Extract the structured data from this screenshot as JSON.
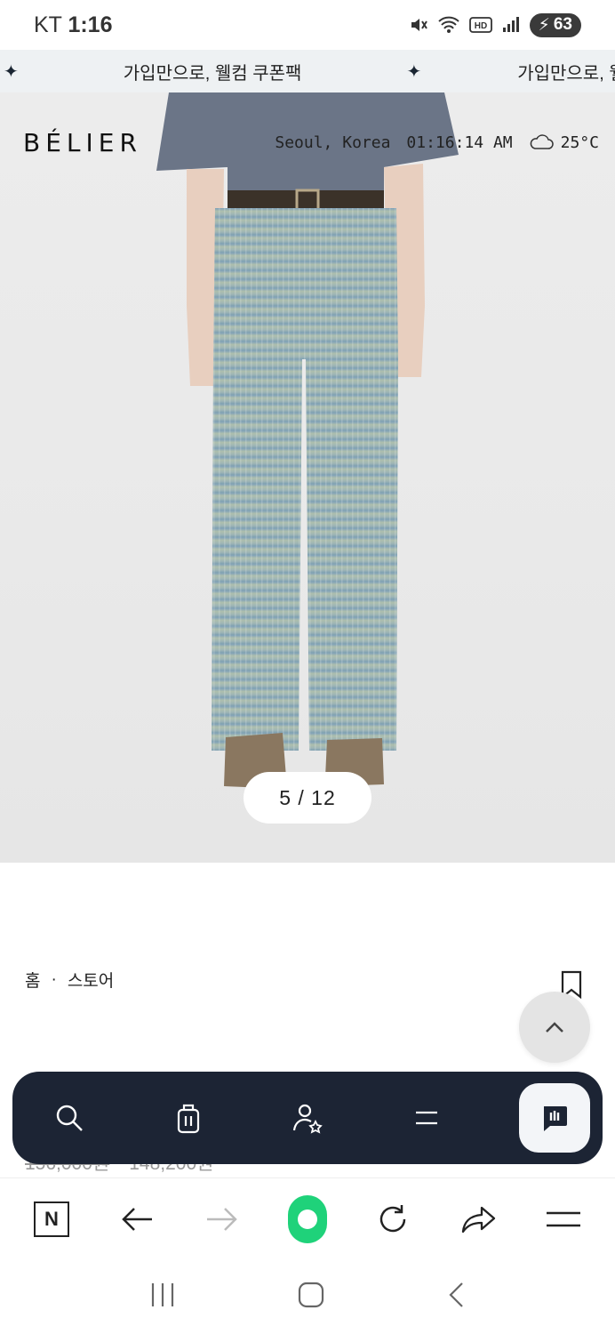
{
  "status_bar": {
    "carrier": "KT",
    "time": "1:16",
    "battery": "63"
  },
  "promo": {
    "items": [
      "가입만으로, 웰컴 쿠폰팩",
      "가입만으로, 웰컴 쿠폰팩"
    ]
  },
  "header": {
    "logo": "BÉLIER",
    "location": "Seoul, Korea",
    "clock": "01:16:14 AM",
    "temperature": "25°C"
  },
  "gallery": {
    "counter": "5 / 12",
    "current": 5,
    "total": 12
  },
  "breadcrumb": {
    "home": "홈",
    "separator": "·",
    "store": "스토어"
  },
  "behind": {
    "old_price": "156,000원",
    "price": "148,200원"
  },
  "floating_nav": {
    "icons": [
      "search-icon",
      "shopping-bag-icon",
      "user-star-icon",
      "menu-icon",
      "chat-icon"
    ]
  },
  "browser_toolbar": {
    "n_label": "N"
  },
  "colors": {
    "nav_dark": "#1c2434",
    "green": "#1fd27a",
    "promo_bg": "#eef1f3"
  }
}
